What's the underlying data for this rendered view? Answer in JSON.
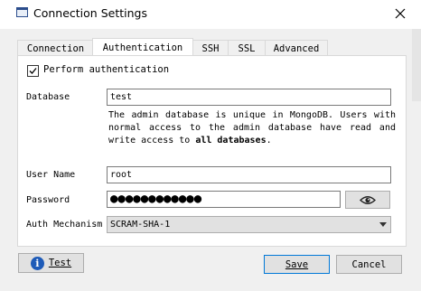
{
  "window": {
    "title": "Connection Settings",
    "close_symbol": "✕"
  },
  "tabs": [
    {
      "label": "Connection",
      "active": false
    },
    {
      "label": "Authentication",
      "active": true
    },
    {
      "label": "SSH",
      "active": false
    },
    {
      "label": "SSL",
      "active": false
    },
    {
      "label": "Advanced",
      "active": false
    }
  ],
  "auth": {
    "perform_label": "Perform authentication",
    "perform_checked": true,
    "database_label": "Database",
    "database_value": "test",
    "description_part1": "The admin database is unique in MongoDB. Users with normal access to the admin database have read and write access to ",
    "description_bold": "all databases",
    "description_end": ".",
    "username_label": "User Name",
    "username_value": "root",
    "password_label": "Password",
    "password_mask": "●●●●●●●●●●●●",
    "mechanism_label": "Auth Mechanism",
    "mechanism_value": "SCRAM-SHA-1"
  },
  "buttons": {
    "test_label": "Test",
    "save_label": "Save",
    "cancel_label": "Cancel"
  },
  "icons": {
    "window": "window-icon",
    "eye": "eye-icon",
    "info": "info-icon",
    "dropdown": "chevron-down-icon"
  },
  "colors": {
    "accent": "#0078d7",
    "info": "#1e5bb8"
  }
}
